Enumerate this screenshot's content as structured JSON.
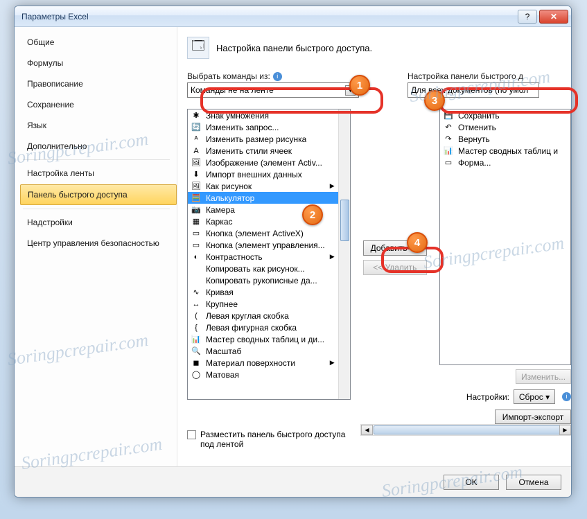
{
  "watermark": "Soringpcrepair.com",
  "window": {
    "title": "Параметры Excel"
  },
  "sidebar": {
    "items": [
      {
        "label": "Общие"
      },
      {
        "label": "Формулы"
      },
      {
        "label": "Правописание"
      },
      {
        "label": "Сохранение"
      },
      {
        "label": "Язык"
      },
      {
        "label": "Дополнительно"
      }
    ],
    "items2": [
      {
        "label": "Настройка ленты"
      },
      {
        "label": "Панель быстрого доступа"
      }
    ],
    "items3": [
      {
        "label": "Надстройки"
      },
      {
        "label": "Центр управления безопасностью"
      }
    ]
  },
  "main": {
    "header": "Настройка панели быстрого доступа.",
    "choose_label": "Выбрать команды из:",
    "choose_value": "Команды не на ленте",
    "customize_label": "Настройка панели быстрого д",
    "customize_value": "Для всех документов (по умол",
    "left_list": [
      {
        "ic": "✱",
        "label": "Знак умножения"
      },
      {
        "ic": "🔄",
        "label": "Изменить запрос..."
      },
      {
        "ic": "ᴬ",
        "label": "Изменить размер рисунка"
      },
      {
        "ic": "A",
        "label": "Изменить стили ячеек"
      },
      {
        "ic": "🖼",
        "label": "Изображение (элемент Activ..."
      },
      {
        "ic": "⬇",
        "label": "Импорт внешних данных"
      },
      {
        "ic": "🖼",
        "label": "Как рисунок",
        "arrow": true
      },
      {
        "ic": "🧮",
        "label": "Калькулятор",
        "sel": true
      },
      {
        "ic": "📷",
        "label": "Камера"
      },
      {
        "ic": "▦",
        "label": "Каркас"
      },
      {
        "ic": "▭",
        "label": "Кнопка (элемент ActiveX)"
      },
      {
        "ic": "▭",
        "label": "Кнопка (элемент управления..."
      },
      {
        "ic": "◐",
        "label": "Контрастность",
        "arrow": true
      },
      {
        "ic": "",
        "label": "Копировать как рисунок..."
      },
      {
        "ic": "",
        "label": "Копировать рукописные да..."
      },
      {
        "ic": "∿",
        "label": "Кривая"
      },
      {
        "ic": "↔",
        "label": "Крупнее"
      },
      {
        "ic": "(",
        "label": "Левая круглая скобка"
      },
      {
        "ic": "{",
        "label": "Левая фигурная скобка"
      },
      {
        "ic": "📊",
        "label": "Мастер сводных таблиц и ди..."
      },
      {
        "ic": "🔍",
        "label": "Масштаб"
      },
      {
        "ic": "◼",
        "label": "Материал поверхности",
        "arrow": true
      },
      {
        "ic": "◯",
        "label": "Матовая"
      }
    ],
    "right_list": [
      {
        "ic": "💾",
        "label": "Сохранить"
      },
      {
        "ic": "↶",
        "label": "Отменить"
      },
      {
        "ic": "↷",
        "label": "Вернуть"
      },
      {
        "ic": "📊",
        "label": "Мастер сводных таблиц и"
      },
      {
        "ic": "▭",
        "label": "Форма..."
      }
    ],
    "add_btn": "Добавить >>",
    "remove_btn": "<< Удалить",
    "modify_btn": "Изменить...",
    "customizations_label": "Настройки:",
    "reset_btn": "Сброс ▾",
    "import_btn": "Импорт-экспорт",
    "checkbox_label": "Разместить панель быстрого доступа под лентой"
  },
  "footer": {
    "ok": "OK",
    "cancel": "Отмена"
  },
  "badges": {
    "b1": "1",
    "b2": "2",
    "b3": "3",
    "b4": "4"
  }
}
